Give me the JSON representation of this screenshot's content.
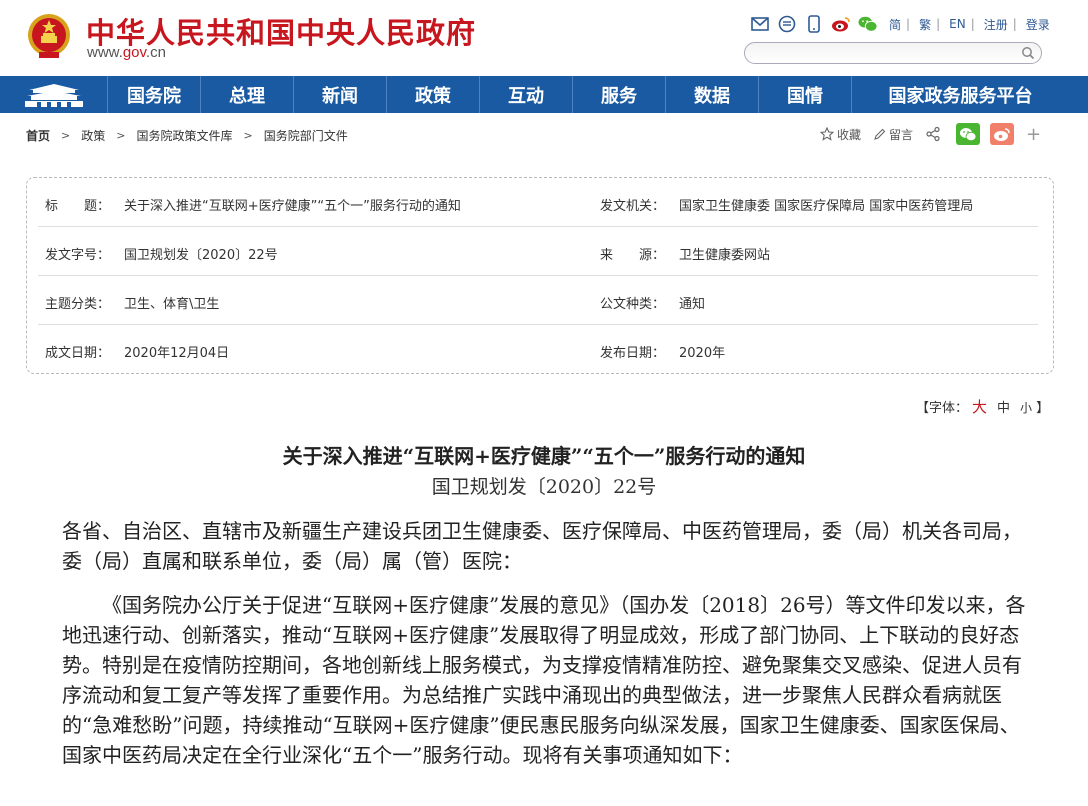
{
  "header": {
    "site_title": "中华人民共和国中央人民政府",
    "site_url_prefix": "www.",
    "site_url_gov": "gov",
    "site_url_suffix": ".cn",
    "lang_links": [
      "简",
      "繁",
      "EN",
      "注册",
      "登录"
    ],
    "util_icons": [
      "mail-icon",
      "message-icon",
      "mobile-icon",
      "weibo-icon",
      "wechat-icon"
    ],
    "search_placeholder": ""
  },
  "nav": {
    "items": [
      "国务院",
      "总理",
      "新闻",
      "政策",
      "互动",
      "服务",
      "数据",
      "国情",
      "国家政务服务平台"
    ]
  },
  "breadcrumb": [
    "首页",
    "政策",
    "国务院政策文件库",
    "国务院部门文件"
  ],
  "tools": {
    "favorite": "收藏",
    "comment": "留言",
    "plus": "+"
  },
  "info": {
    "rows": [
      {
        "label1": "标　　题：",
        "value1": "关于深入推进“互联网+医疗健康”“五个一”服务行动的通知",
        "label2": "发文机关：",
        "value2": "国家卫生健康委  国家医疗保障局  国家中医药管理局"
      },
      {
        "label1": "发文字号：",
        "value1": "国卫规划发〔2020〕22号",
        "label2": "来　　源：",
        "value2": "卫生健康委网站"
      },
      {
        "label1": "主题分类：",
        "value1": "卫生、体育\\卫生",
        "label2": "公文种类：",
        "value2": "通知"
      },
      {
        "label1": "成文日期：",
        "value1": "2020年12月04日",
        "label2": "发布日期：",
        "value2": "2020年"
      }
    ]
  },
  "font_size": {
    "prefix": "【字体：",
    "big": "大",
    "mid": "中",
    "small": "小",
    "suffix": "】"
  },
  "article": {
    "title": "关于深入推进“互联网+医疗健康”“五个一”服务行动的通知",
    "doc_no": "国卫规划发〔2020〕22号",
    "para1": "各省、自治区、直辖市及新疆生产建设兵团卫生健康委、医疗保障局、中医药管理局，委（局）机关各司局，委（局）直属和联系单位，委（局）属（管）医院：",
    "para2": "《国务院办公厅关于促进“互联网+医疗健康”发展的意见》（国办发〔2018〕26号）等文件印发以来，各地迅速行动、创新落实，推动“互联网+医疗健康”发展取得了明显成效，形成了部门协同、上下联动的良好态势。特别是在疫情防控期间，各地创新线上服务模式，为支撑疫情精准防控、避免聚集交叉感染、促进人员有序流动和复工复产等发挥了重要作用。为总结推广实践中涌现出的典型做法，进一步聚焦人民群众看病就医的“急难愁盼”问题，持续推动“互联网+医疗健康”便民惠民服务向纵深发展，国家卫生健康委、国家医保局、国家中医药局决定在全行业深化“五个一”服务行动。现将有关事项通知如下："
  },
  "colors": {
    "brand_red": "#c7161e",
    "nav_blue": "#1a5aa2",
    "wechat_green": "#4ab530",
    "weibo_pink": "#f1806a"
  }
}
